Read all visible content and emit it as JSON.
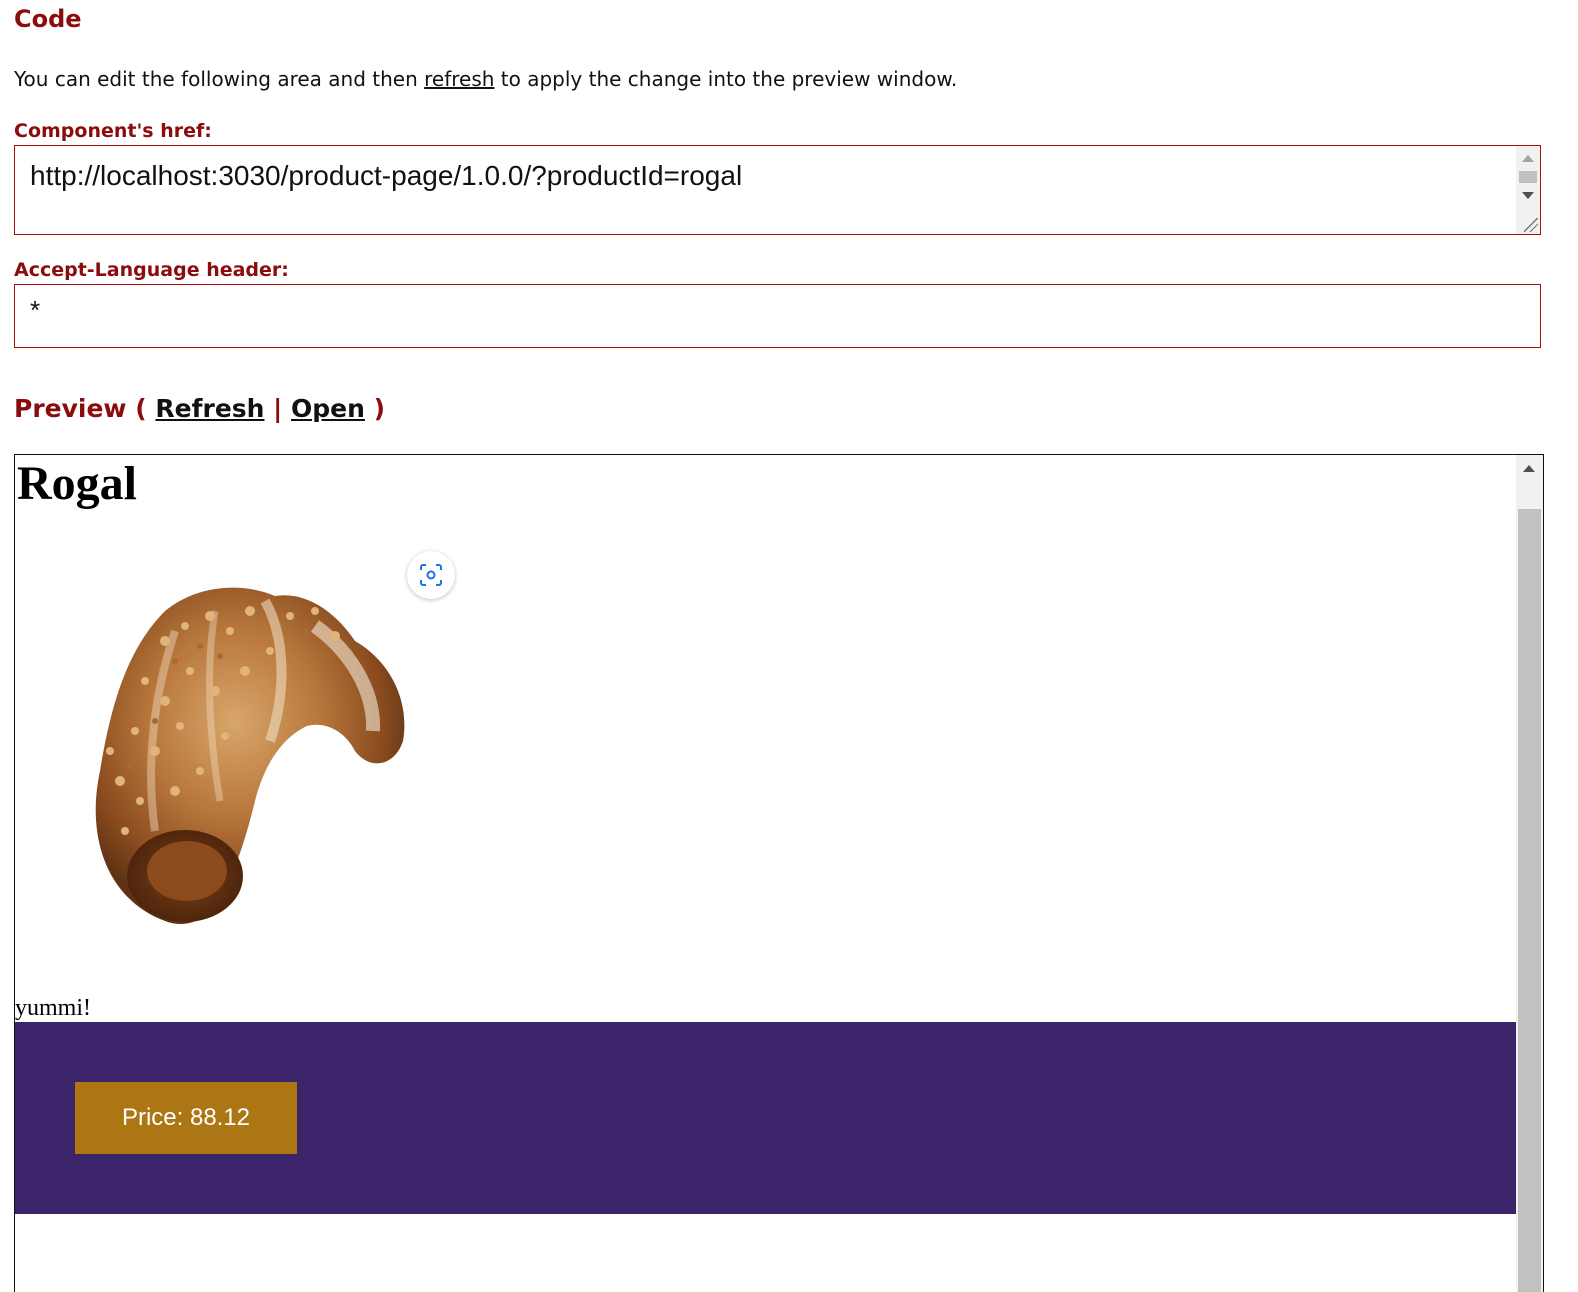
{
  "code_section": {
    "heading": "Code",
    "intro_before": "You can edit the following area and then ",
    "intro_link": "refresh",
    "intro_after": " to apply the change into the preview window."
  },
  "href_field": {
    "label": "Component's href:",
    "value": "http://localhost:3030/product-page/1.0.0/?productId=rogal"
  },
  "language_field": {
    "label": "Accept-Language header:",
    "value": "*"
  },
  "preview_section": {
    "heading": "Preview",
    "open_paren": "(",
    "refresh_link": "Refresh",
    "separator": "|",
    "open_link": "Open",
    "close_paren": ")"
  },
  "product": {
    "title": "Rogal",
    "image_subject": "rogal pastry with glaze and chopped nuts",
    "description": "yummi!",
    "price_button": "Price: 88.12"
  },
  "colors": {
    "accent": "#8b0c0c",
    "field_border": "#a50f0f",
    "price_band": "#3b246a",
    "price_button": "#ac7614"
  },
  "icons": {
    "lens": "visual-search-icon"
  }
}
